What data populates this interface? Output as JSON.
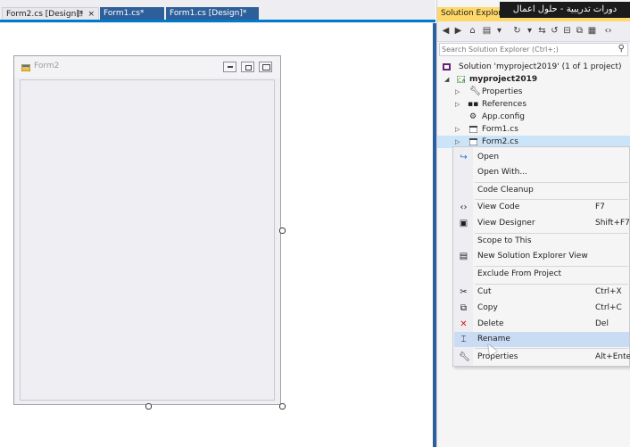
{
  "tabs": [
    {
      "label": "Form2.cs [Design]*",
      "active": true
    },
    {
      "label": "Form1.cs*",
      "active": false
    },
    {
      "label": "Form1.cs [Design]*",
      "active": false
    }
  ],
  "tab_icons": {
    "pin": "pin-icon",
    "close": "×"
  },
  "form": {
    "title": "Form2"
  },
  "solution_explorer": {
    "title": "Solution Explorer",
    "search_placeholder": "Search Solution Explorer (Ctrl+;)",
    "search_icon": "⚲",
    "tree": [
      {
        "label": "Solution 'myproject2019' (1 of 1 project)"
      },
      {
        "label": "myproject2019"
      },
      {
        "label": "Properties"
      },
      {
        "label": "References"
      },
      {
        "label": "App.config"
      },
      {
        "label": "Form1.cs"
      },
      {
        "label": "Form2.cs"
      }
    ]
  },
  "watermark": {
    "text": "دورات تدريبية - حلول اعمال"
  },
  "context_menu": {
    "items": [
      {
        "label": "Open",
        "shortcut": ""
      },
      {
        "label": "Open With...",
        "shortcut": ""
      },
      {
        "label": "Code Cleanup",
        "shortcut": ""
      },
      {
        "label": "View Code",
        "shortcut": "F7"
      },
      {
        "label": "View Designer",
        "shortcut": "Shift+F7"
      },
      {
        "label": "Scope to This",
        "shortcut": ""
      },
      {
        "label": "New Solution Explorer View",
        "shortcut": ""
      },
      {
        "label": "Exclude From Project",
        "shortcut": ""
      },
      {
        "label": "Cut",
        "shortcut": "Ctrl+X"
      },
      {
        "label": "Copy",
        "shortcut": "Ctrl+C"
      },
      {
        "label": "Delete",
        "shortcut": "Del"
      },
      {
        "label": "Rename",
        "shortcut": ""
      },
      {
        "label": "Properties",
        "shortcut": "Alt+Enter"
      }
    ]
  },
  "colors": {
    "accent": "#007acc",
    "highlight": "#c9dcf4",
    "selected_row": "#cce4f7"
  }
}
